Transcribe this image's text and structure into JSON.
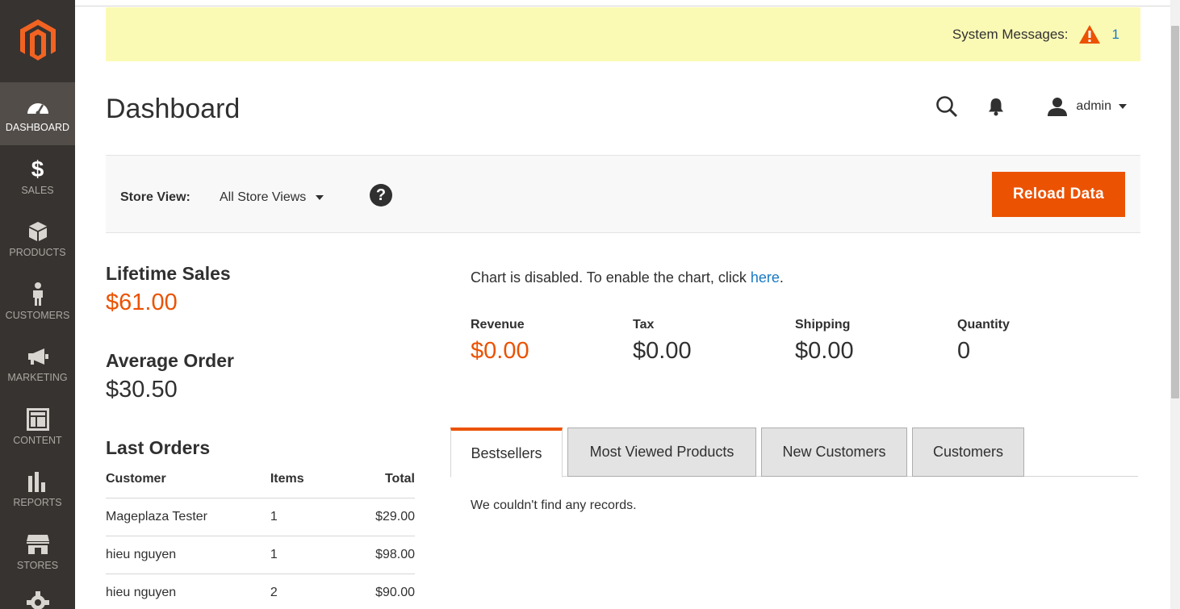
{
  "sidebar": {
    "items": [
      {
        "label": "DASHBOARD",
        "icon": "dashboard-icon"
      },
      {
        "label": "SALES",
        "icon": "dollar-icon"
      },
      {
        "label": "PRODUCTS",
        "icon": "box-icon"
      },
      {
        "label": "CUSTOMERS",
        "icon": "person-icon"
      },
      {
        "label": "MARKETING",
        "icon": "megaphone-icon"
      },
      {
        "label": "CONTENT",
        "icon": "layout-icon"
      },
      {
        "label": "REPORTS",
        "icon": "bar-chart-icon"
      },
      {
        "label": "STORES",
        "icon": "storefront-icon"
      }
    ]
  },
  "system_messages": {
    "label": "System Messages:",
    "count": "1"
  },
  "header": {
    "title": "Dashboard",
    "user": "admin"
  },
  "store_bar": {
    "label": "Store View:",
    "selected": "All Store Views",
    "help": "?",
    "reload_label": "Reload Data"
  },
  "lifetime_sales": {
    "label": "Lifetime Sales",
    "value": "$61.00"
  },
  "average_order": {
    "label": "Average Order",
    "value": "$30.50"
  },
  "last_orders": {
    "title": "Last Orders",
    "columns": {
      "customer": "Customer",
      "items": "Items",
      "total": "Total"
    },
    "rows": [
      {
        "customer": "Mageplaza Tester",
        "items": "1",
        "total": "$29.00"
      },
      {
        "customer": "hieu nguyen",
        "items": "1",
        "total": "$98.00"
      },
      {
        "customer": "hieu nguyen",
        "items": "2",
        "total": "$90.00"
      }
    ]
  },
  "chart_notice": {
    "text": "Chart is disabled. To enable the chart, click ",
    "link": "here",
    "end": "."
  },
  "totals": [
    {
      "label": "Revenue",
      "value": "$0.00"
    },
    {
      "label": "Tax",
      "value": "$0.00"
    },
    {
      "label": "Shipping",
      "value": "$0.00"
    },
    {
      "label": "Quantity",
      "value": "0"
    }
  ],
  "tabs": [
    {
      "label": "Bestsellers",
      "active": true
    },
    {
      "label": "Most Viewed Products",
      "active": false
    },
    {
      "label": "New Customers",
      "active": false
    },
    {
      "label": "Customers",
      "active": false
    }
  ],
  "tab_content": {
    "empty": "We couldn't find any records."
  },
  "colors": {
    "accent": "#eb5202",
    "link": "#1979c3",
    "sidebar": "#373330",
    "notice": "#fbfab5"
  }
}
